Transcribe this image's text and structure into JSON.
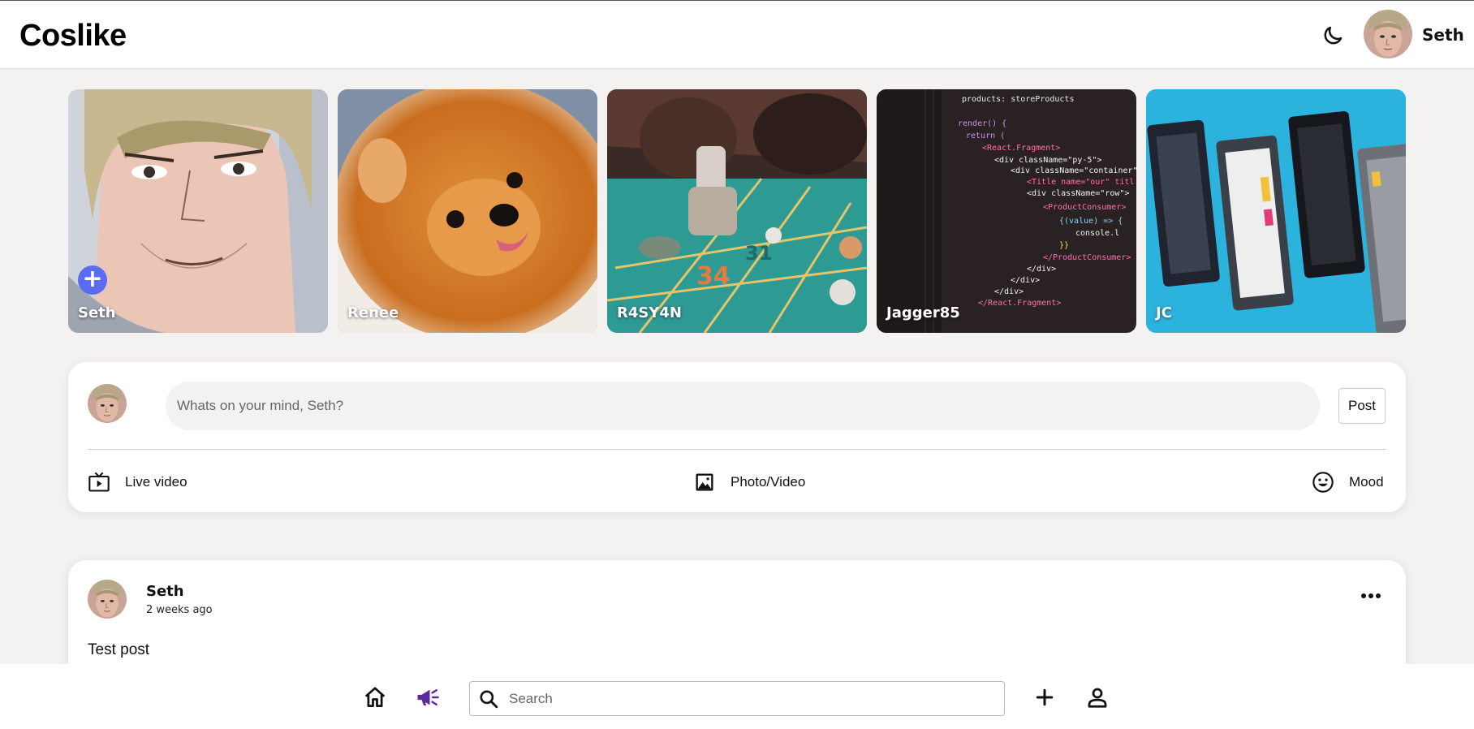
{
  "app": {
    "title": "Coslike"
  },
  "header": {
    "user_name": "Seth",
    "theme_icon": "moon-icon"
  },
  "stories": [
    {
      "label": "Seth",
      "has_add_button": true,
      "add_label": "+"
    },
    {
      "label": "Renee"
    },
    {
      "label": "R4SY4N"
    },
    {
      "label": "Jagger85"
    },
    {
      "label": "JC"
    }
  ],
  "composer": {
    "placeholder": "Whats on your mind, Seth?",
    "post_label": "Post",
    "actions": [
      {
        "label": "Live video",
        "icon": "live-video-icon"
      },
      {
        "label": "Photo/Video",
        "icon": "image-icon"
      },
      {
        "label": "Mood",
        "icon": "smiley-icon"
      }
    ]
  },
  "post": {
    "author": "Seth",
    "time": "2 weeks ago",
    "text": "Test post",
    "menu_icon": "more-horizontal-icon"
  },
  "bottom_nav": {
    "search_placeholder": "Search",
    "icons": [
      "home-icon",
      "megaphone-icon",
      "search-icon",
      "plus-icon",
      "user-icon"
    ],
    "accent": "#5b2a9e"
  }
}
